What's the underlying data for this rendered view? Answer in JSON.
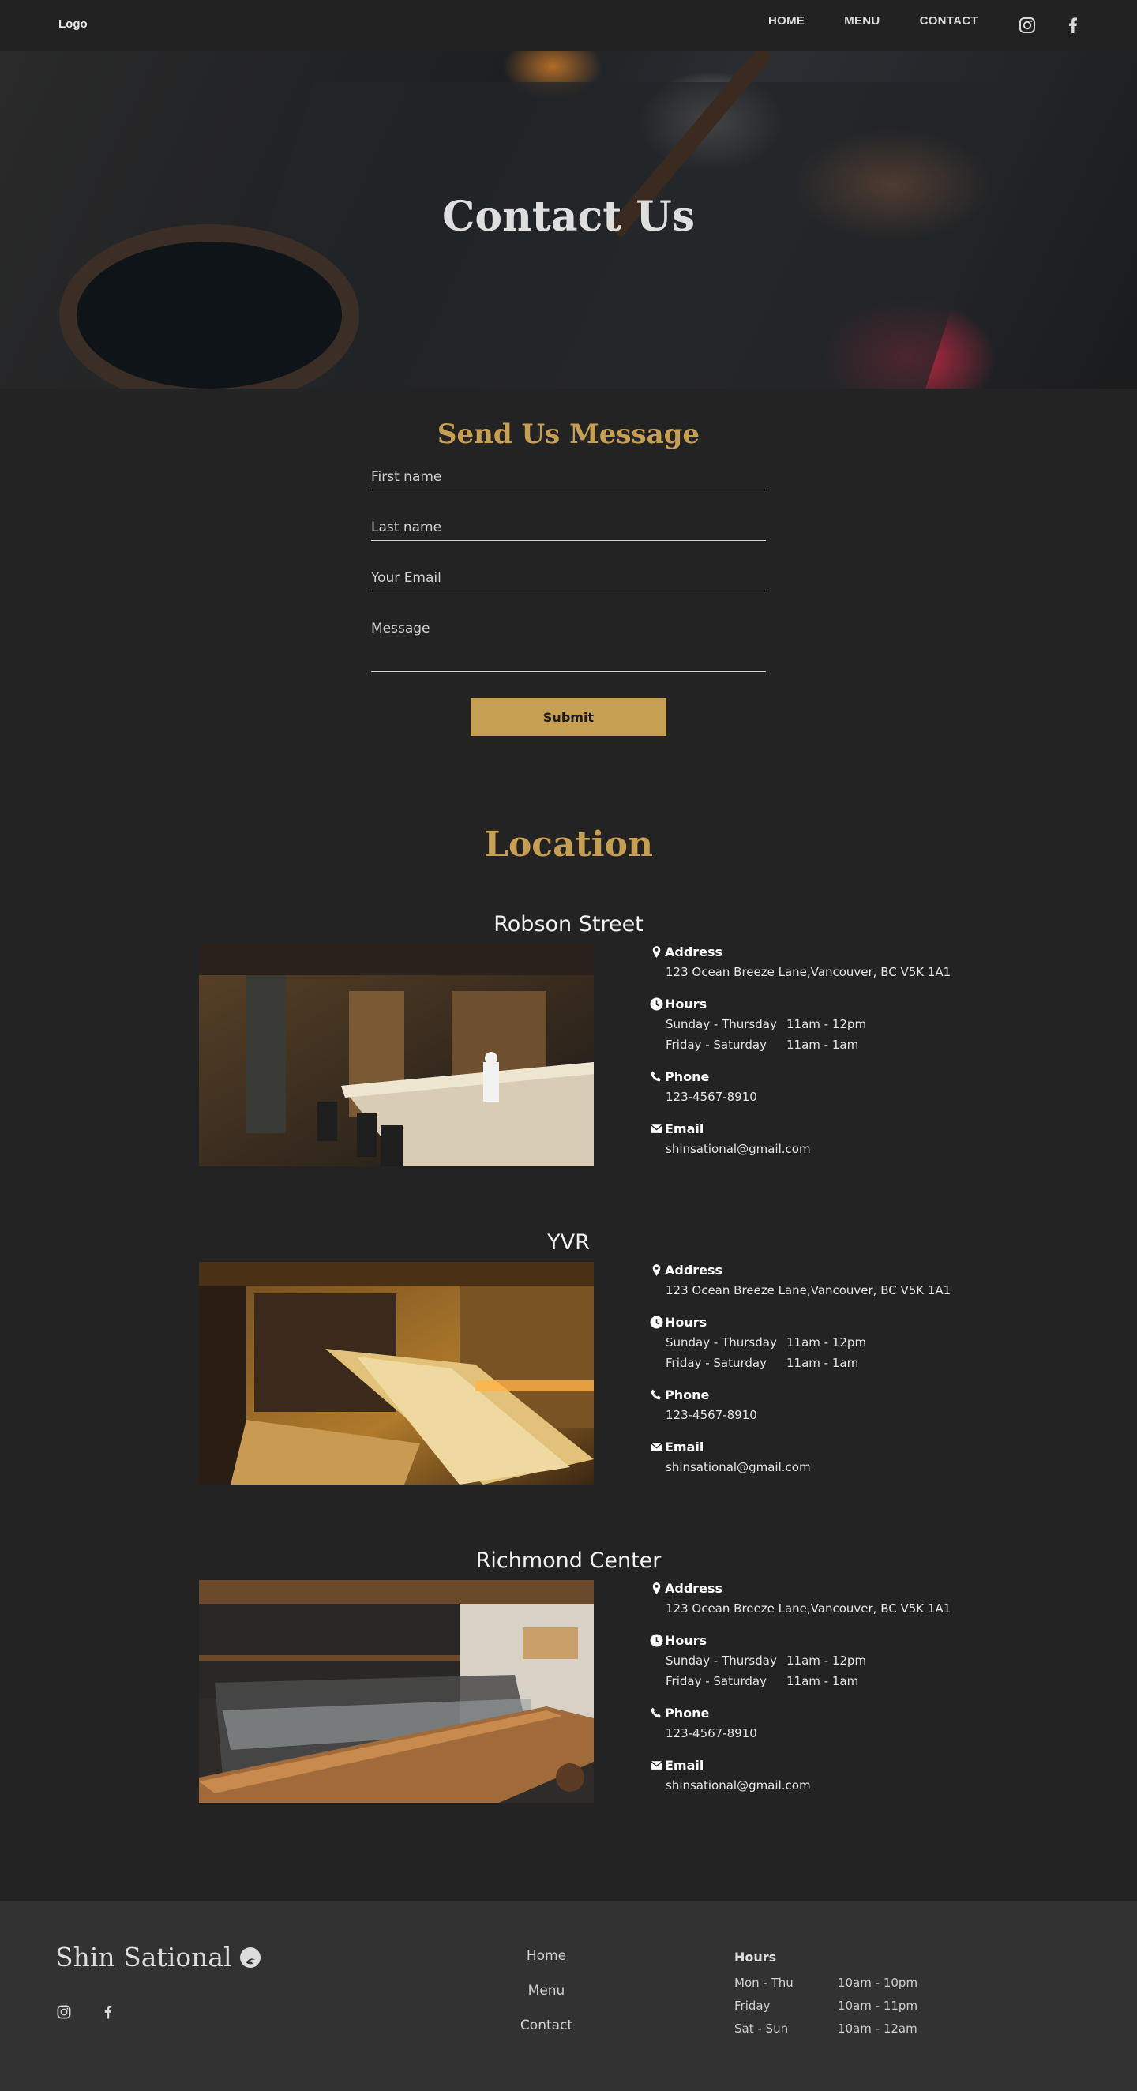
{
  "nav": {
    "logo": "Logo",
    "links": [
      "HOME",
      "MENU",
      "CONTACT"
    ],
    "social": [
      "instagram-icon",
      "facebook-icon"
    ]
  },
  "hero": {
    "title": "Contact Us"
  },
  "form": {
    "title": "Send Us Message",
    "fields": [
      "First name",
      "Last name",
      "Your Email",
      "Message"
    ],
    "submit": "Submit"
  },
  "location": {
    "title": "Location",
    "labels": {
      "address": "Address",
      "hours": "Hours",
      "phone": "Phone",
      "email": "Email"
    },
    "branches": [
      {
        "name": "Robson Street",
        "address": "123 Ocean Breeze Lane,Vancouver, BC V5K 1A1",
        "hours": [
          {
            "days": "Sunday - Thursday",
            "time": "11am - 12pm"
          },
          {
            "days": "Friday - Saturday",
            "time": "11am - 1am"
          }
        ],
        "phone": "123-4567-8910",
        "email": "shinsational@gmail.com"
      },
      {
        "name": "YVR",
        "address": "123 Ocean Breeze Lane,Vancouver, BC V5K 1A1",
        "hours": [
          {
            "days": "Sunday - Thursday",
            "time": "11am - 12pm"
          },
          {
            "days": "Friday - Saturday",
            "time": "11am - 1am"
          }
        ],
        "phone": "123-4567-8910",
        "email": "shinsational@gmail.com"
      },
      {
        "name": "Richmond Center",
        "address": "123 Ocean Breeze Lane,Vancouver, BC V5K 1A1",
        "hours": [
          {
            "days": "Sunday - Thursday",
            "time": "11am - 12pm"
          },
          {
            "days": "Friday - Saturday",
            "time": "11am - 1am"
          }
        ],
        "phone": "123-4567-8910",
        "email": "shinsational@gmail.com"
      }
    ]
  },
  "footer": {
    "brand": "Shin Sational",
    "links": [
      "Home",
      "Menu",
      "Contact"
    ],
    "hours_title": "Hours",
    "hours": [
      {
        "days": "Mon - Thu",
        "time": "10am - 10pm"
      },
      {
        "days": "Friday",
        "time": "10am - 11pm"
      },
      {
        "days": "Sat - Sun",
        "time": "10am - 12am"
      }
    ]
  },
  "colors": {
    "accent": "#c79f53",
    "background": "#232323",
    "footer": "#323232"
  }
}
